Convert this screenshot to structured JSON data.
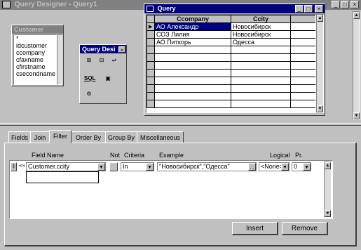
{
  "app": {
    "title": "Query Designer - Query1"
  },
  "window_buttons": {
    "minimize": "_",
    "maximize": "□",
    "close": "×"
  },
  "table_panel": {
    "title": "Customer",
    "fields": [
      "*",
      "idcustomer",
      "ccompany",
      "cfaxname",
      "cfirstname",
      "csecondname"
    ]
  },
  "toolbar": {
    "title": "Query Desi",
    "sql_label": "SQL",
    "close": "×"
  },
  "results": {
    "title": "Query",
    "columns": [
      "Ccompany",
      "Ccity"
    ],
    "rows": [
      [
        "АО Александр",
        "Новосибирск"
      ],
      [
        "СОЗ Лилия",
        "Новосибирск"
      ],
      [
        "АО Питкорь",
        "Одесса"
      ]
    ]
  },
  "tabs": [
    "Fields",
    "Join",
    "Filter",
    "Order By",
    "Group By",
    "Miscellaneous"
  ],
  "filter": {
    "headers": {
      "field_name": "Field Name",
      "not": "Not",
      "criteria": "Criteria",
      "example": "Example",
      "logical": "Logical",
      "pr": "Pr."
    },
    "row": {
      "field": "Customer.ccity",
      "criteria": "In",
      "example": "\"Новосибирск\",\"Одесса\"",
      "logical": "<None>",
      "pr": "0"
    }
  },
  "buttons": {
    "insert": "Insert",
    "remove": "Remove"
  }
}
